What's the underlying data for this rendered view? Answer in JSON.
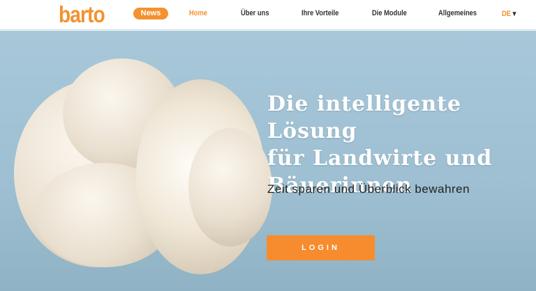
{
  "header": {
    "logo": "barto",
    "news_label": "News",
    "nav": [
      "Home",
      "Über uns",
      "Ihre Vorteile",
      "Die Module",
      "Allgemeines"
    ],
    "language": "DE"
  },
  "hero": {
    "title_lines": [
      "Die intelligente Lösung",
      "für Landwirte und",
      "Bäuerinnen"
    ],
    "subtitle": "Zeit sparen und Überblick bewahren",
    "login_label": "LOGIN"
  },
  "colors": {
    "accent": "#f39230",
    "background": "#a8c8da"
  }
}
